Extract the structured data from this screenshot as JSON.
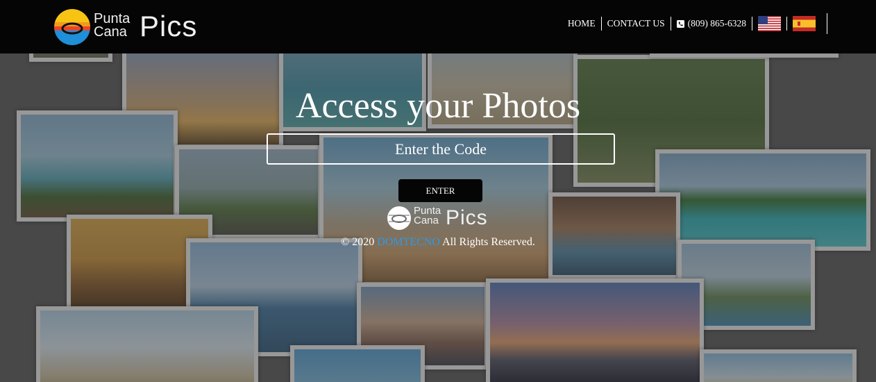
{
  "header": {
    "logo": {
      "line1": "Punta",
      "line2": "Cana",
      "big": "Pics"
    },
    "nav": {
      "home": "HOME",
      "contact": "CONTACT US",
      "phone": "(809) 865-6328"
    },
    "flags": [
      "us-flag-icon",
      "spain-flag-icon"
    ]
  },
  "main": {
    "title": "Access your Photos",
    "code_placeholder": "Enter the Code",
    "enter_label": "ENTER",
    "footer_logo": {
      "line1": "Punta",
      "line2": "Cana",
      "big": "Pics"
    },
    "copyright_prefix": "© 2020",
    "copyright_company": "DOMTECNO",
    "copyright_suffix": "All Rights Reserved."
  },
  "colors": {
    "header_bg": "#050505",
    "link": "#2e9ae6",
    "button_bg": "#050505"
  }
}
